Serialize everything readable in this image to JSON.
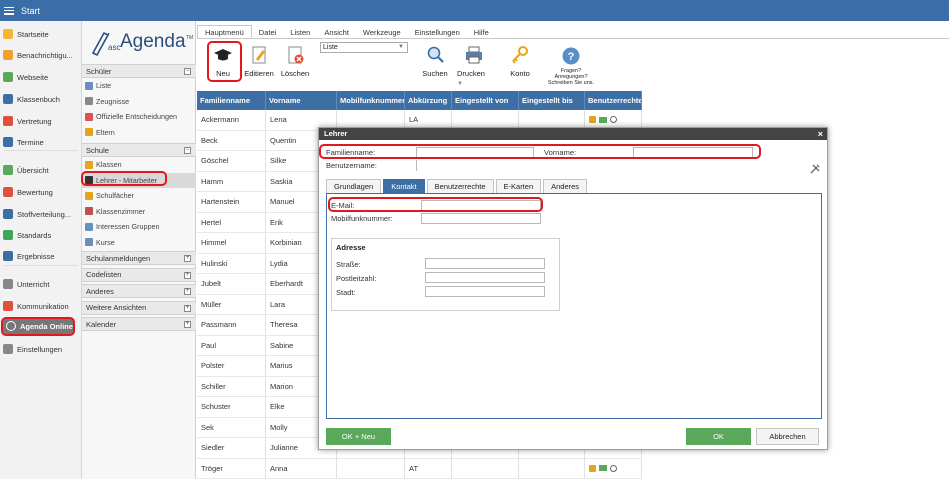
{
  "topbar": {
    "title": "Start"
  },
  "leftnav": {
    "items": [
      {
        "label": "Startseite",
        "icon": "star-icon",
        "color": "#f2b632"
      },
      {
        "label": "Benachrichtigu...",
        "icon": "envelope-icon",
        "color": "#f0a030"
      },
      {
        "label": "Webseite",
        "icon": "home-icon",
        "color": "#5aa85a"
      },
      {
        "label": "Klassenbuch",
        "icon": "book-icon",
        "color": "#3d6fa4"
      },
      {
        "label": "Vertretung",
        "icon": "substitution-icon",
        "color": "#e0503a"
      },
      {
        "label": "Termine",
        "icon": "calendar-icon",
        "color": "#3d6fa4"
      },
      {
        "label": "Übersicht",
        "icon": "check-icon",
        "color": "#5aa85a"
      },
      {
        "label": "Bewertung",
        "icon": "rating-icon",
        "color": "#e0503a"
      },
      {
        "label": "Stoffverteilung...",
        "icon": "distribution-icon",
        "color": "#3d6fa4"
      },
      {
        "label": "Standards",
        "icon": "shield-icon",
        "color": "#3da65a"
      },
      {
        "label": "Ergebnisse",
        "icon": "chart-icon",
        "color": "#3d6fa4"
      },
      {
        "label": "Unterricht",
        "icon": "lesson-icon",
        "color": "#888888"
      },
      {
        "label": "Kommunikation",
        "icon": "communication-icon",
        "color": "#e0503a"
      },
      {
        "label": "Agenda Online",
        "icon": "agenda-icon",
        "color": "#ffffff"
      },
      {
        "label": "Einstellungen",
        "icon": "gear-icon",
        "color": "#888888"
      }
    ]
  },
  "col2": {
    "logo": {
      "prefix": "asc",
      "word": "Agenda",
      "tm": "TM"
    },
    "sections": [
      {
        "title": "Schüler",
        "toggle": "−",
        "items": [
          "Liste",
          "Zeugnisse",
          "Offizielle Entscheidungen",
          "Eltern"
        ]
      },
      {
        "title": "Schule",
        "toggle": "−",
        "items": [
          "Klassen",
          "Lehrer - Mitarbeiter",
          "Schulfächer",
          "Klassenzimmer",
          "Interessen Gruppen",
          "Kurse"
        ]
      }
    ],
    "collapsed": [
      {
        "title": "Schulanmeldungen",
        "toggle": "+"
      },
      {
        "title": "Codelisten",
        "toggle": "+"
      },
      {
        "title": "Anderes",
        "toggle": "+"
      },
      {
        "title": "Weitere Ansichten",
        "toggle": "+"
      },
      {
        "title": "Kalender",
        "toggle": "+"
      }
    ]
  },
  "menubar": {
    "tabs": [
      "Hauptmenü",
      "Datei",
      "Listen",
      "Ansicht",
      "Werkzeuge",
      "Einstellungen",
      "Hilfe"
    ]
  },
  "ribbon": {
    "new": "Neu",
    "edit": "Editieren",
    "delete": "Löschen",
    "list_select": "Liste",
    "search": "Suchen",
    "print": "Drucken",
    "account": "Konto",
    "help_line1": "Fragen?",
    "help_line2": "Anregungen?",
    "help_line3": "Schreiben Sie uns."
  },
  "table": {
    "headers": [
      "Familienname",
      "Vorname",
      "Mobilfunknummer",
      "Abkürzung",
      "Eingestellt von",
      "Eingestellt bis",
      "Benutzerrechte"
    ],
    "rows": [
      [
        "Ackermann",
        "Lena",
        "",
        "LA"
      ],
      [
        "Beck",
        "Quentin",
        "",
        ""
      ],
      [
        "Göschel",
        "Silke",
        "",
        ""
      ],
      [
        "Hamm",
        "Saskia",
        "",
        ""
      ],
      [
        "Hartenstein",
        "Manuel",
        "",
        ""
      ],
      [
        "Hertel",
        "Erik",
        "",
        ""
      ],
      [
        "Himmel",
        "Korbinian",
        "",
        ""
      ],
      [
        "Hulinski",
        "Lydia",
        "",
        ""
      ],
      [
        "Jubelt",
        "Eberhardt",
        "",
        ""
      ],
      [
        "Müller",
        "Lara",
        "",
        ""
      ],
      [
        "Passmann",
        "Theresa",
        "",
        ""
      ],
      [
        "Paul",
        "Sabine",
        "",
        ""
      ],
      [
        "Polster",
        "Marius",
        "",
        ""
      ],
      [
        "Schiller",
        "Marion",
        "",
        ""
      ],
      [
        "Schuster",
        "Elke",
        "",
        ""
      ],
      [
        "Sek",
        "Molly",
        "",
        ""
      ],
      [
        "Siedler",
        "Julianne",
        "",
        ""
      ],
      [
        "Tröger",
        "Anna",
        "",
        "AT"
      ]
    ]
  },
  "dialog": {
    "title": "Lehrer",
    "close": "×",
    "familienname_label": "Familienname:",
    "vorname_label": "Vorname:",
    "benutzername_label": "Benutzername:",
    "tabs": [
      "Grundlagen",
      "Kontakt",
      "Benutzerrechte",
      "E-Karten",
      "Anderes"
    ],
    "email_label": "E-Mail:",
    "mobil_label": "Mobilfunknummer:",
    "adresse_title": "Adresse",
    "strasse_label": "Straße:",
    "plz_label": "Postleitzahl:",
    "stadt_label": "Stadt:",
    "ok_neu": "OK + Neu",
    "ok": "OK",
    "cancel": "Abbrechen"
  }
}
